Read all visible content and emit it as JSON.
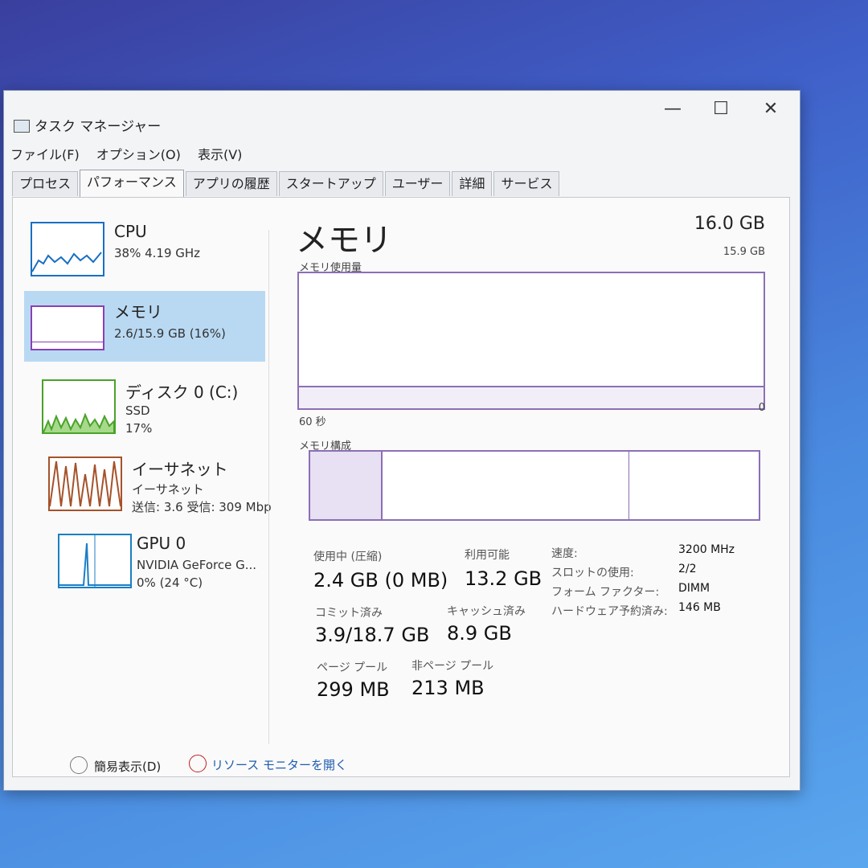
{
  "window": {
    "title": "タスク マネージャー",
    "controls": {
      "minimize": "—",
      "maximize": "☐",
      "close": "✕"
    }
  },
  "menu": [
    "ファイル(F)",
    "オプション(O)",
    "表示(V)"
  ],
  "tabs": [
    "プロセス",
    "パフォーマンス",
    "アプリの履歴",
    "スタートアップ",
    "ユーザー",
    "詳細",
    "サービス"
  ],
  "active_tab": "パフォーマンス",
  "sidebar": {
    "items": [
      {
        "name": "CPU",
        "sub1": "38%  4.19 GHz",
        "sub2": "",
        "color": "#1a6fc4"
      },
      {
        "name": "メモリ",
        "sub1": "2.6/15.9 GB (16%)",
        "sub2": "",
        "color": "#8b3fb5"
      },
      {
        "name": "ディスク 0 (C:)",
        "sub1": "SSD",
        "sub2": "17%",
        "color": "#4aa32a"
      },
      {
        "name": "イーサネット",
        "sub1": "イーサネット",
        "sub2": "送信: 3.6 受信: 309 Mbp",
        "color": "#a5522a"
      },
      {
        "name": "GPU 0",
        "sub1": "NVIDIA GeForce G...",
        "sub2": "0% (24 °C)",
        "color": "#1a7fc4"
      }
    ]
  },
  "main": {
    "title": "メモリ",
    "total": "16.0 GB",
    "graph_label": "メモリ使用量",
    "graph_max": "15.9 GB",
    "graph_time": "60 秒",
    "graph_min": "0",
    "composition_label": "メモリ構成",
    "stats": {
      "in_use_label": "使用中 (圧縮)",
      "in_use_value": "2.4 GB (0 MB)",
      "available_label": "利用可能",
      "available_value": "13.2 GB",
      "committed_label": "コミット済み",
      "committed_value": "3.9/18.7 GB",
      "cached_label": "キャッシュ済み",
      "cached_value": "8.9 GB",
      "paged_label": "ページ プール",
      "paged_value": "299 MB",
      "nonpaged_label": "非ページ プール",
      "nonpaged_value": "213 MB"
    },
    "specs": [
      {
        "label": "速度:",
        "value": "3200 MHz"
      },
      {
        "label": "スロットの使用:",
        "value": "2/2"
      },
      {
        "label": "フォーム ファクター:",
        "value": "DIMM"
      },
      {
        "label": "ハードウェア予約済み:",
        "value": "146 MB"
      }
    ]
  },
  "footer": {
    "fewer_details": "簡易表示(D)",
    "resource_monitor": "リソース モニターを開く"
  }
}
